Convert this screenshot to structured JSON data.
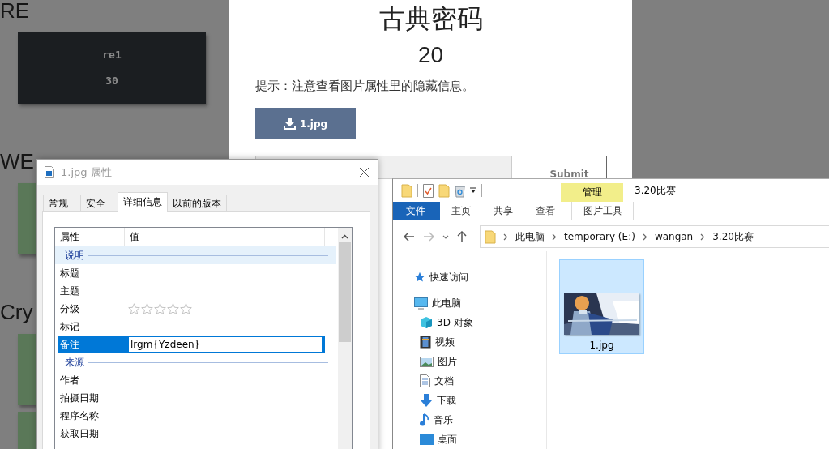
{
  "background_page": {
    "sections": [
      {
        "heading": "RE",
        "cards": [
          {
            "kind": "dark",
            "name": "re1",
            "score": "30"
          }
        ]
      },
      {
        "heading": "WE",
        "cards": [
          {
            "kind": "solved"
          }
        ]
      },
      {
        "heading": "Cry",
        "cards": [
          {
            "kind": "solved"
          },
          {
            "kind": "solved"
          }
        ]
      }
    ]
  },
  "challenge_modal": {
    "title": "古典密码",
    "points": "20",
    "hint": "提示：注意查看图片属性里的隐藏信息。",
    "download_button": "1.jpg",
    "submit_button": "Submit"
  },
  "properties_dialog": {
    "title": "1.jpg 属性",
    "tabs": [
      {
        "label": "常规",
        "selected": false
      },
      {
        "label": "安全",
        "selected": false
      },
      {
        "label": "详细信息",
        "selected": true
      },
      {
        "label": "以前的版本",
        "selected": false
      }
    ],
    "columns": [
      "属性",
      "值"
    ],
    "rows": [
      {
        "kind": "group",
        "label": "说明",
        "highlighted": true
      },
      {
        "kind": "property",
        "label": "标题",
        "selected": false
      },
      {
        "kind": "property",
        "label": "主题",
        "selected": false
      },
      {
        "kind": "property",
        "label": "分级",
        "stars": 0,
        "selected": false
      },
      {
        "kind": "property",
        "label": "标记",
        "selected": false
      },
      {
        "kind": "property",
        "label": "备注",
        "value": "lrgm{Yzdeen}",
        "selected": true
      },
      {
        "kind": "group",
        "label": "来源",
        "highlighted": false
      },
      {
        "kind": "property",
        "label": "作者",
        "selected": false
      },
      {
        "kind": "property",
        "label": "拍摄日期",
        "selected": false
      },
      {
        "kind": "property",
        "label": "程序名称",
        "selected": false
      },
      {
        "kind": "property",
        "label": "获取日期",
        "selected": false
      }
    ]
  },
  "explorer": {
    "context_tab": "管理",
    "title": "3.20比赛",
    "ribbon_tabs": [
      {
        "label": "文件",
        "kind": "file"
      },
      {
        "label": "主页",
        "kind": "tab"
      },
      {
        "label": "共享",
        "kind": "tab"
      },
      {
        "label": "查看",
        "kind": "tab"
      },
      {
        "label": "图片工具",
        "kind": "context"
      }
    ],
    "breadcrumb": [
      "此电脑",
      "temporary (E:)",
      "wangan",
      "3.20比赛"
    ],
    "navigation": [
      {
        "label": "快速访问"
      },
      {
        "label": "此电脑",
        "children": [
          {
            "label": "3D 对象"
          },
          {
            "label": "视频"
          },
          {
            "label": "图片"
          },
          {
            "label": "文档"
          },
          {
            "label": "下载"
          },
          {
            "label": "音乐"
          },
          {
            "label": "桌面"
          }
        ]
      }
    ],
    "files": [
      {
        "name": "1.jpg",
        "kind": "picture",
        "selected": true
      }
    ]
  }
}
